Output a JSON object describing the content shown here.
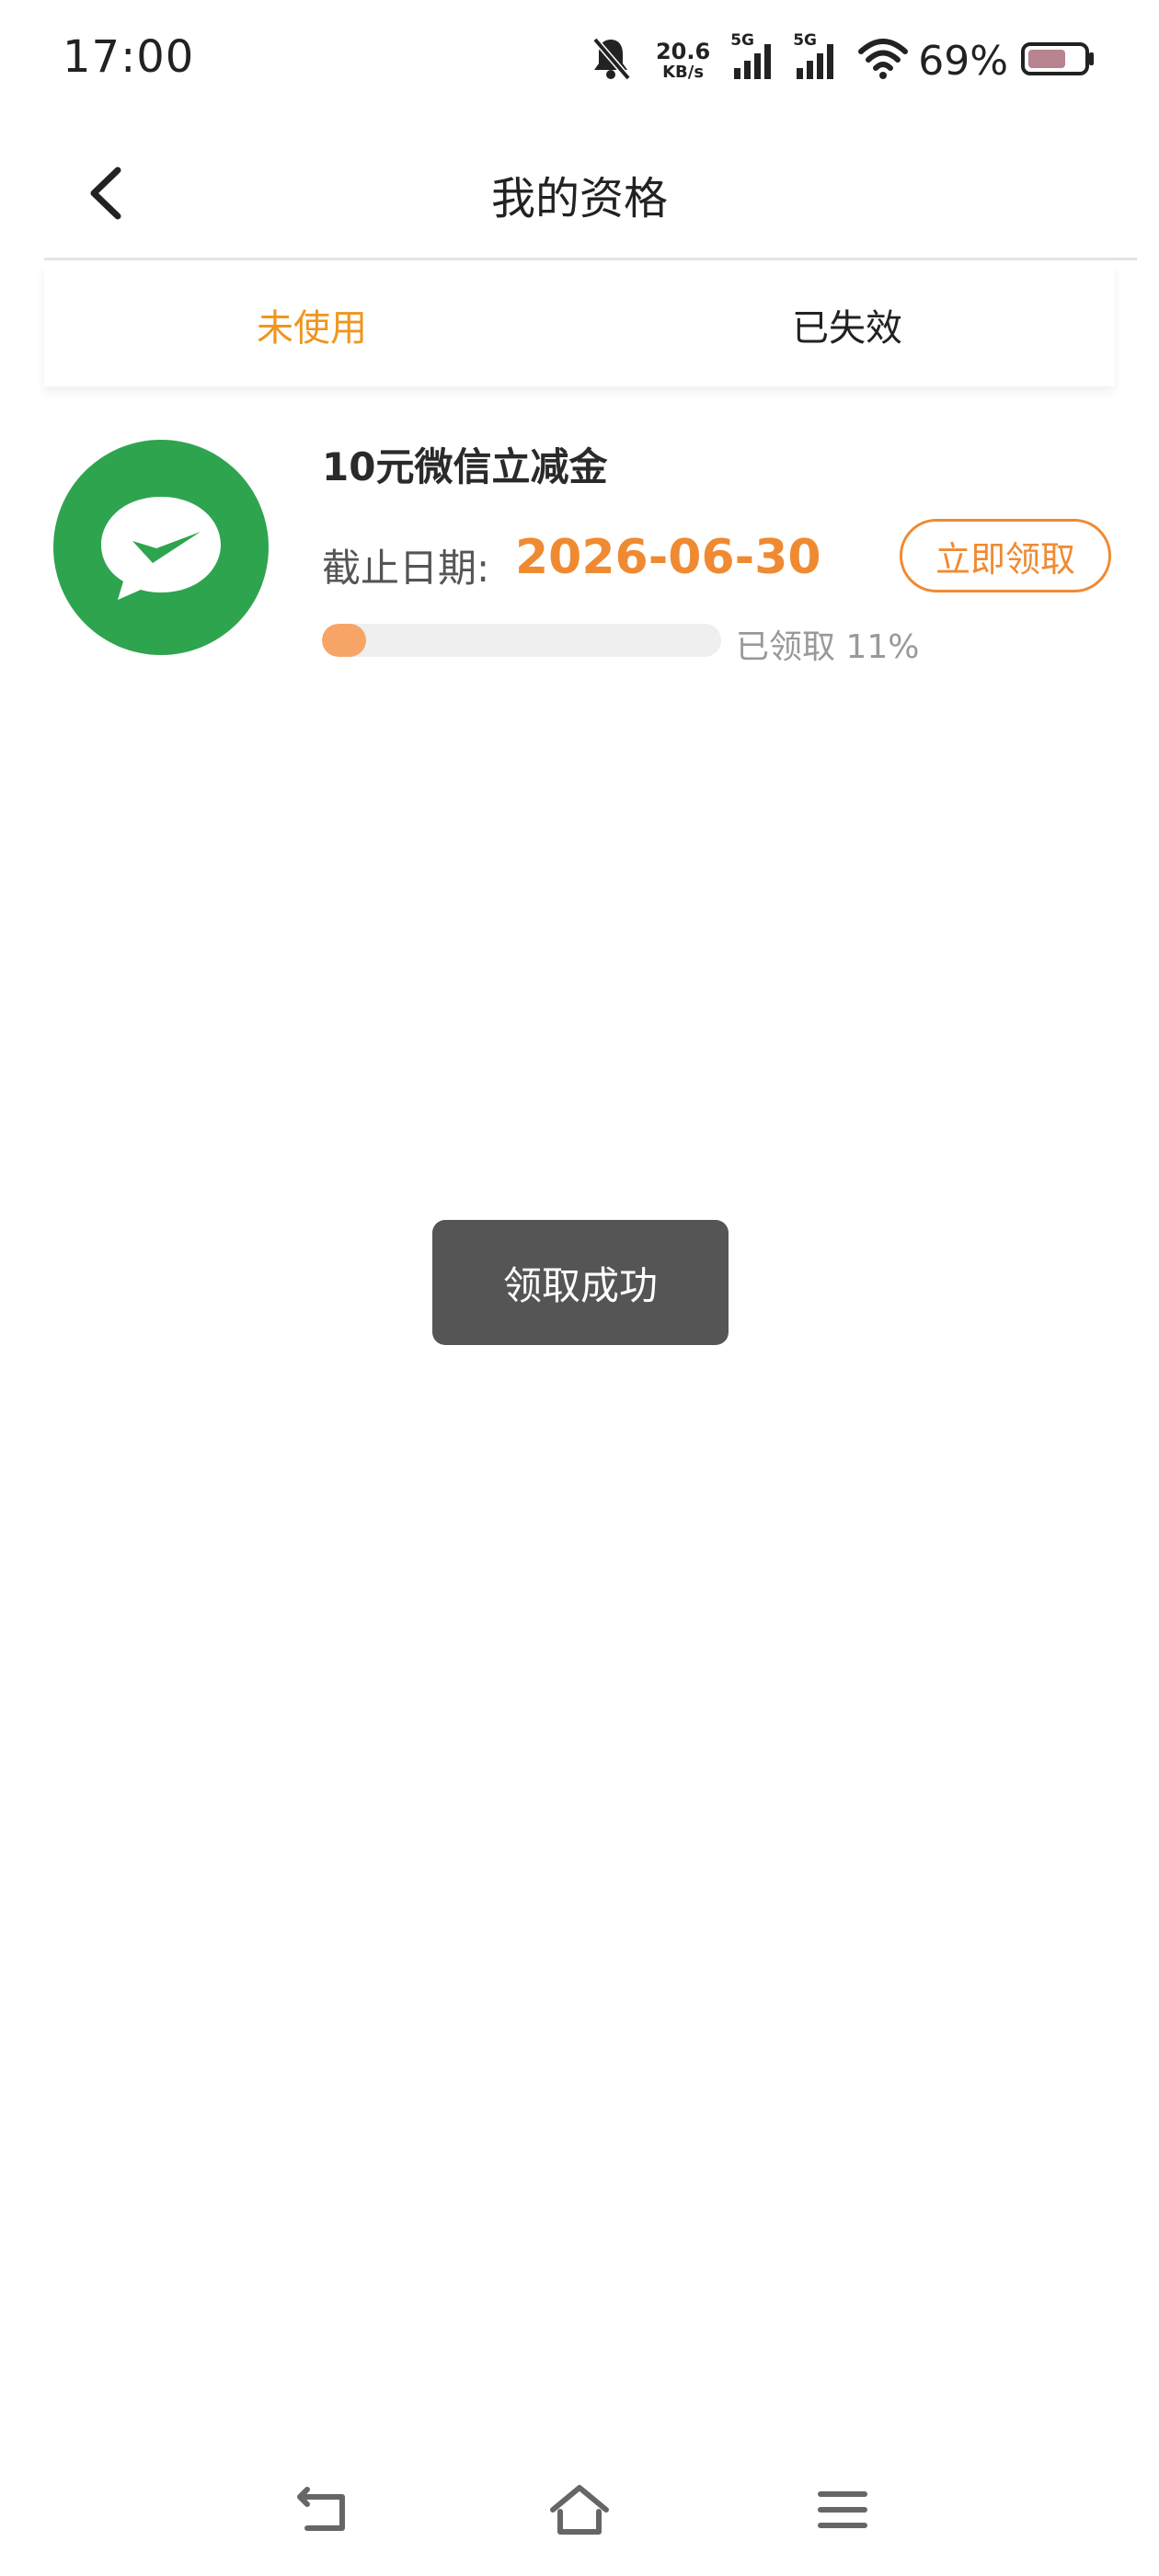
{
  "status_bar": {
    "time": "17:00",
    "net_speed_value": "20.6",
    "net_speed_unit": "KB/s",
    "sim1_tag": "5G",
    "sim2_tag": "5G",
    "battery_percent": "69%",
    "battery_level": 0.69,
    "icons": [
      "bell-muted-icon",
      "signal-icon",
      "signal-icon",
      "wifi-icon",
      "battery-icon"
    ]
  },
  "header": {
    "title": "我的资格",
    "back_icon": "chevron-left-icon"
  },
  "tabs": [
    {
      "label": "未使用",
      "active": true
    },
    {
      "label": "已失效",
      "active": false
    }
  ],
  "coupon": {
    "icon": "wechat-pay-icon",
    "title": "10元微信立减金",
    "deadline_label": "截止日期:",
    "deadline_value": "2026-06-30",
    "claim_button": "立即领取",
    "progress_text": "已领取 11%",
    "progress_fraction": 0.11
  },
  "toast": {
    "message": "领取成功"
  },
  "nav_bar": {
    "icons": [
      "back-icon",
      "home-icon",
      "menu-icon"
    ]
  },
  "colors": {
    "accent_orange": "#f08a32",
    "tab_active": "#f0951e",
    "progress_fill": "#f7a567",
    "wechat_green": "#2ea44f",
    "toast_bg": "#555555"
  }
}
